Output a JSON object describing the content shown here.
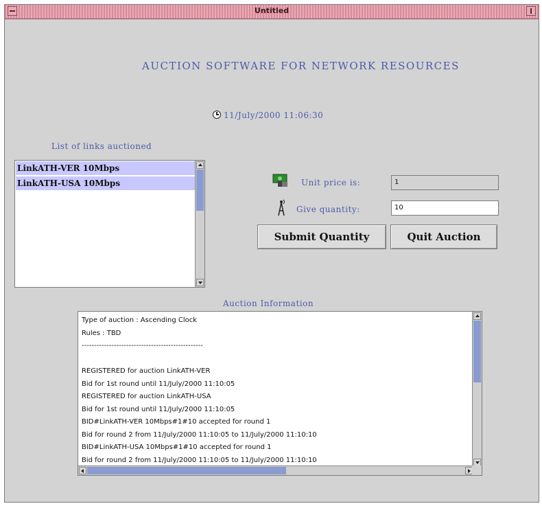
{
  "window": {
    "title": "Untitled"
  },
  "heading": "AUCTION SOFTWARE FOR NETWORK RESOURCES",
  "clock": {
    "icon": "clock-icon",
    "timestamp": "11/July/2000 11:06:30"
  },
  "links": {
    "label": "List of links auctioned",
    "items": [
      "LinkATH-VER 10Mbps",
      "LinkATH-USA 10Mbps"
    ]
  },
  "unit_price": {
    "icon": "money-icon",
    "label": "Unit price is:",
    "value": "1"
  },
  "quantity": {
    "icon": "antenna-icon",
    "label": "Give quantity:",
    "value": "10"
  },
  "buttons": {
    "submit": "Submit Quantity",
    "quit": "Quit Auction"
  },
  "info": {
    "label": "Auction Information",
    "lines": [
      "Type of auction : Ascending Clock",
      "Rules : TBD",
      "-------------------------------------------------",
      "",
      "REGISTERED for auction LinkATH-VER",
      "Bid for 1st round until 11/July/2000 11:10:05",
      "REGISTERED for auction LinkATH-USA",
      "Bid for 1st round until 11/July/2000 11:10:05",
      "BID#LinkATH-VER 10Mbps#1#10 accepted for round 1",
      "Bid for round 2 from 11/July/2000 11:10:05 to 11/July/2000 11:10:10",
      "BID#LinkATH-USA 10Mbps#1#10 accepted for round 1",
      "Bid for round 2 from 11/July/2000 11:10:05 to 11/July/2000 11:10:10"
    ]
  },
  "colors": {
    "label_blue": "#4a5ba8",
    "selection": "#c8c8ff",
    "titlebar": "#d98a9a",
    "scroll_thumb": "#8a9ccf"
  }
}
